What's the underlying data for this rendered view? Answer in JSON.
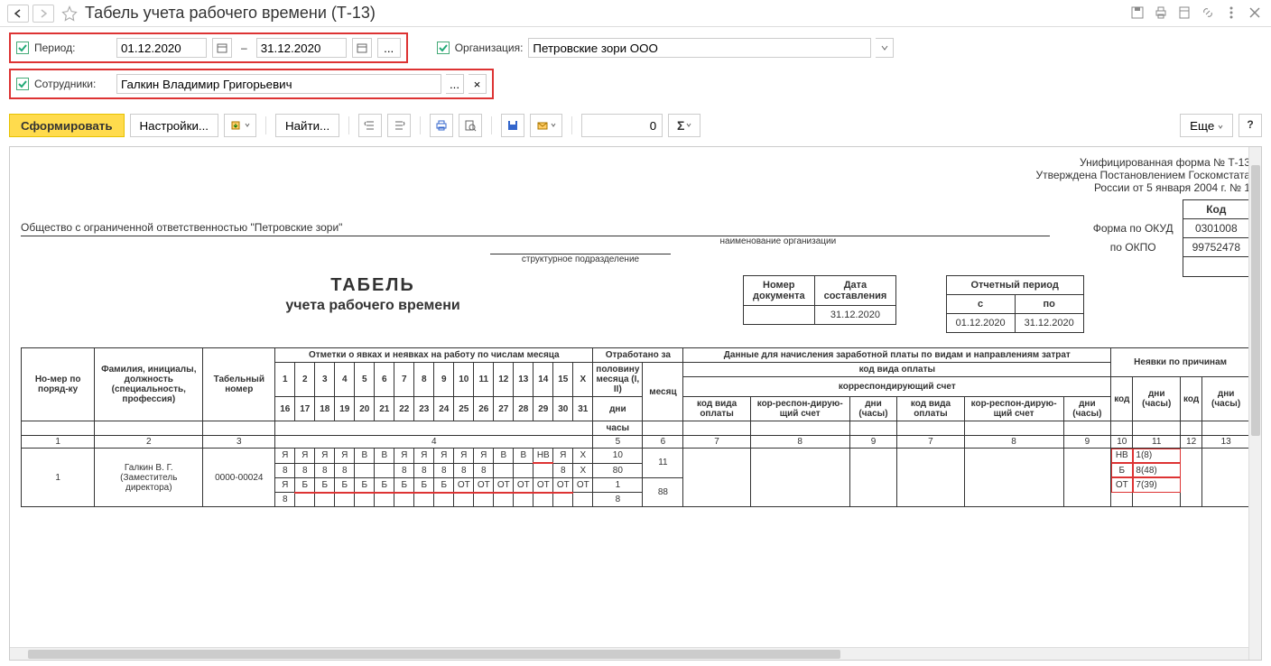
{
  "page": {
    "title": "Табель учета рабочего времени (Т-13)"
  },
  "params": {
    "period_label": "Период:",
    "date_from": "01.12.2020",
    "date_to": "31.12.2020",
    "dots": "...",
    "org_label": "Организация:",
    "org_value": "Петровские зори ООО",
    "emp_label": "Сотрудники:",
    "emp_value": "Галкин Владимир Григорьевич"
  },
  "toolbar": {
    "generate": "Сформировать",
    "settings": "Настройки...",
    "find": "Найти...",
    "num": "0",
    "more": "Еще",
    "help": "?"
  },
  "report": {
    "form_line1": "Унифицированная форма № Т-13",
    "form_line2": "Утверждена Постановлением Госкомстата",
    "form_line3": "России от 5 января 2004 г. № 1",
    "code_hdr": "Код",
    "okud_label": "Форма по ОКУД",
    "okud_value": "0301008",
    "okpo_label": "по ОКПО",
    "okpo_value": "99752478",
    "org_full": "Общество с ограниченной ответственностью \"Петровские зори\"",
    "org_cap": "наименование организации",
    "dept_cap": "структурное подразделение",
    "title1": "ТАБЕЛЬ",
    "title2": "учета  рабочего времени",
    "doc_num_hdr": "Номер документа",
    "doc_date_hdr": "Дата составления",
    "doc_date": "31.12.2020",
    "rep_period_hdr": "Отчетный период",
    "period_from_hdr": "с",
    "period_to_hdr": "по",
    "period_from": "01.12.2020",
    "period_to": "31.12.2020"
  },
  "table": {
    "hdr_num": "Но-мер по поряд-ку",
    "hdr_fio": "Фамилия, инициалы, должность (специальность, профессия)",
    "hdr_tabnum": "Табельный номер",
    "hdr_marks": "Отметки о явках и неявках на работу по числам месяца",
    "hdr_worked": "Отработано за",
    "hdr_half": "половину месяца (I, II)",
    "hdr_month": "месяц",
    "hdr_days": "дни",
    "hdr_hours": "часы",
    "hdr_pay": "Данные для начисления заработной платы по видам и направлениям затрат",
    "hdr_paycode": "код вида оплаты",
    "hdr_corr": "корреспондирующий счет",
    "hdr_kvo": "код вида оплаты",
    "hdr_ks": "кор-респон-дирую-щий счет",
    "hdr_dh": "дни (часы)",
    "hdr_absent": "Неявки по причинам",
    "hdr_code": "код",
    "days1": [
      "1",
      "2",
      "3",
      "4",
      "5",
      "6",
      "7",
      "8",
      "9",
      "10",
      "11",
      "12",
      "13",
      "14",
      "15",
      "Х"
    ],
    "days2": [
      "16",
      "17",
      "18",
      "19",
      "20",
      "21",
      "22",
      "23",
      "24",
      "25",
      "26",
      "27",
      "28",
      "29",
      "30",
      "31"
    ],
    "colnums": [
      "1",
      "2",
      "3",
      "4",
      "5",
      "6",
      "7",
      "8",
      "9",
      "7",
      "8",
      "9",
      "10",
      "11",
      "12",
      "13"
    ],
    "emp_name": "Галкин В. Г. (Заместитель директора)",
    "emp_num": "1",
    "emp_tab": "0000-00024",
    "row1": [
      "Я",
      "Я",
      "Я",
      "Я",
      "В",
      "В",
      "Я",
      "Я",
      "Я",
      "Я",
      "Я",
      "В",
      "В",
      "НВ",
      "Я",
      "Х"
    ],
    "row1h": [
      "8",
      "8",
      "8",
      "8",
      "",
      "",
      "8",
      "8",
      "8",
      "8",
      "8",
      "",
      "",
      "",
      "8",
      "Х"
    ],
    "row2": [
      "Я",
      "Б",
      "Б",
      "Б",
      "Б",
      "Б",
      "Б",
      "Б",
      "Б",
      "ОТ",
      "ОТ",
      "ОТ",
      "ОТ",
      "ОТ",
      "ОТ",
      "ОТ"
    ],
    "row2h": [
      "8",
      "",
      "",
      "",
      "",
      "",
      "",
      "",
      "",
      "",
      "",
      "",
      "",
      "",
      "",
      ""
    ],
    "half1_days": "10",
    "half1_hours": "80",
    "half2_days": "1",
    "half2_hours": "8",
    "month_days": "11",
    "month_hours": "88",
    "abs1_code": "НВ",
    "abs1_val": "1(8)",
    "abs2_code": "Б",
    "abs2_val": "8(48)",
    "abs3_code": "ОТ",
    "abs3_val": "7(39)"
  }
}
